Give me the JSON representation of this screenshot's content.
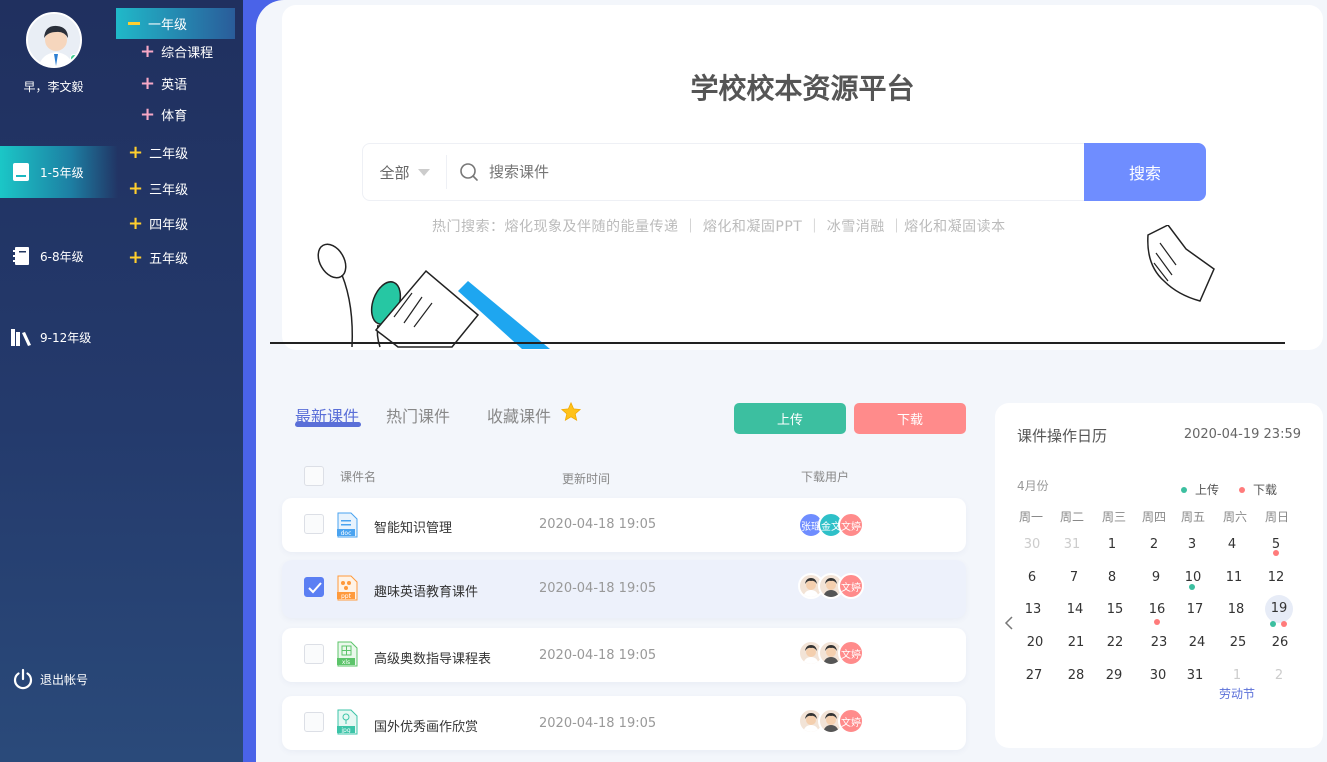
{
  "user": {
    "greeting": "早，李文毅"
  },
  "sidebar": {
    "top_grade": "一年级",
    "top_subjects": [
      "综合课程",
      "英语",
      "体育"
    ],
    "grades": [
      {
        "label": "1-5年级",
        "icon": "book-icon"
      },
      {
        "label": "6-8年级",
        "icon": "notebook-icon"
      },
      {
        "label": "9-12年级",
        "icon": "library-icon"
      }
    ],
    "sub_grades": [
      "二年级",
      "三年级",
      "四年级",
      "五年级"
    ],
    "logout": "退出帐号"
  },
  "hero": {
    "title": "学校校本资源平台",
    "scope": "全部",
    "search_placeholder": "搜索课件",
    "search_button": "搜索",
    "hot_search": "热门搜索：熔化现象及伴随的能量传递 ｜ 熔化和凝固PPT ｜ 冰雪消融 ｜熔化和凝固读本"
  },
  "tabs": {
    "latest": "最新课件",
    "popular": "热门课件",
    "favorites": "收藏课件"
  },
  "actions": {
    "upload": "上传",
    "download": "下载"
  },
  "columns": {
    "name": "课件名",
    "time": "更新时间",
    "users": "下载用户"
  },
  "files": [
    {
      "name": "智能知识管理",
      "time": "2020-04-18 19:05",
      "type": "doc",
      "color": "#4aa3f0",
      "checked": false,
      "users": [
        "张瑶",
        "金文",
        "文婷"
      ]
    },
    {
      "name": "趣味英语教育课件",
      "time": "2020-04-18 19:05",
      "type": "ppt",
      "color": "#ff9a3c",
      "checked": true,
      "users": [
        "",
        "",
        "文婷"
      ]
    },
    {
      "name": "高级奥数指导课程表",
      "time": "2020-04-18 19:05",
      "type": "xls",
      "color": "#5cc46a",
      "checked": false,
      "users": [
        "",
        "",
        "文婷"
      ]
    },
    {
      "name": "国外优秀画作欣赏",
      "time": "2020-04-18 19:05",
      "type": "jpg",
      "color": "#3cc4a8",
      "checked": false,
      "users": [
        "",
        "",
        "文婷"
      ]
    }
  ],
  "calendar": {
    "title": "课件操作日历",
    "datetime": "2020-04-19 23:59",
    "month": "4月份",
    "legend": {
      "upload": "上传",
      "download": "下载"
    },
    "weekdays": [
      "周一",
      "周二",
      "周三",
      "周四",
      "周五",
      "周六",
      "周日"
    ],
    "weeks": [
      [
        "30",
        "31",
        "1",
        "2",
        "3",
        "4",
        "5"
      ],
      [
        "6",
        "7",
        "8",
        "9",
        "10",
        "11",
        "12"
      ],
      [
        "13",
        "14",
        "15",
        "16",
        "17",
        "18",
        "19"
      ],
      [
        "20",
        "21",
        "22",
        "23",
        "24",
        "25",
        "26"
      ],
      [
        "27",
        "28",
        "29",
        "30",
        "31",
        "1",
        "2"
      ]
    ],
    "holiday": "劳动节"
  }
}
